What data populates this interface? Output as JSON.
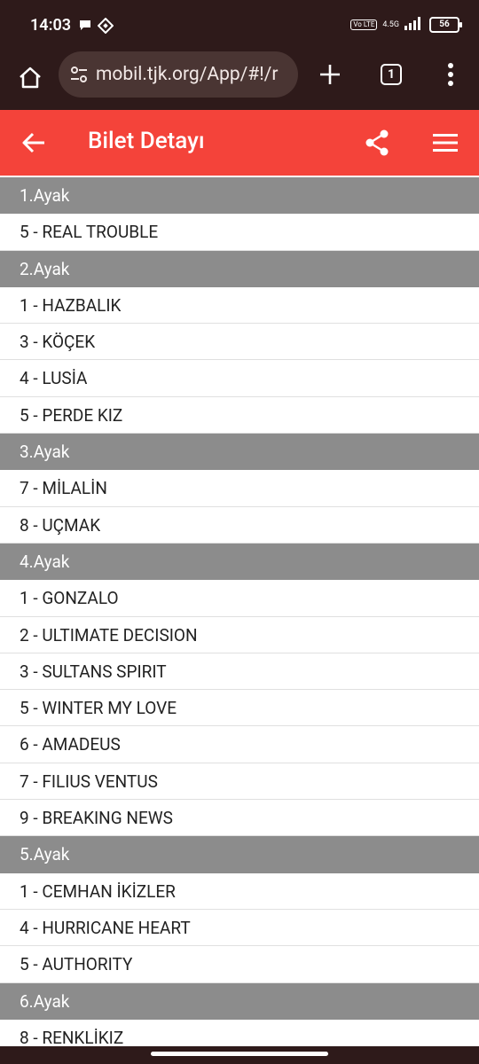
{
  "status_bar": {
    "time": "14:03",
    "volte": "Vo LTE",
    "network": "4.5G",
    "battery": "56"
  },
  "browser": {
    "url": "mobil.tjk.org/App/#!/r",
    "tab_count": "1"
  },
  "app_header": {
    "title": "Bilet Detayı"
  },
  "colors": {
    "header_red": "#f4433a",
    "leg_gray": "#8c8c8c",
    "browser_dark": "#2e1a1a"
  },
  "legs": [
    {
      "label": "1.Ayak",
      "horses": [
        "5 - REAL TROUBLE"
      ]
    },
    {
      "label": "2.Ayak",
      "horses": [
        "1 - HAZBALIK",
        "3 - KÖÇEK",
        "4 - LUSİA",
        "5 - PERDE KIZ"
      ]
    },
    {
      "label": "3.Ayak",
      "horses": [
        "7 - MİLALİN",
        "8 - UÇMAK"
      ]
    },
    {
      "label": "4.Ayak",
      "horses": [
        "1 - GONZALO",
        "2 - ULTIMATE DECISION",
        "3 - SULTANS SPIRIT",
        "5 - WINTER MY LOVE",
        "6 - AMADEUS",
        "7 - FILIUS VENTUS",
        "9 - BREAKING NEWS"
      ]
    },
    {
      "label": "5.Ayak",
      "horses": [
        "1 - CEMHAN İKİZLER",
        "4 - HURRICANE HEART",
        "5 - AUTHORITY"
      ]
    },
    {
      "label": "6.Ayak",
      "horses": [
        "8 - RENKLİKIZ"
      ]
    }
  ]
}
